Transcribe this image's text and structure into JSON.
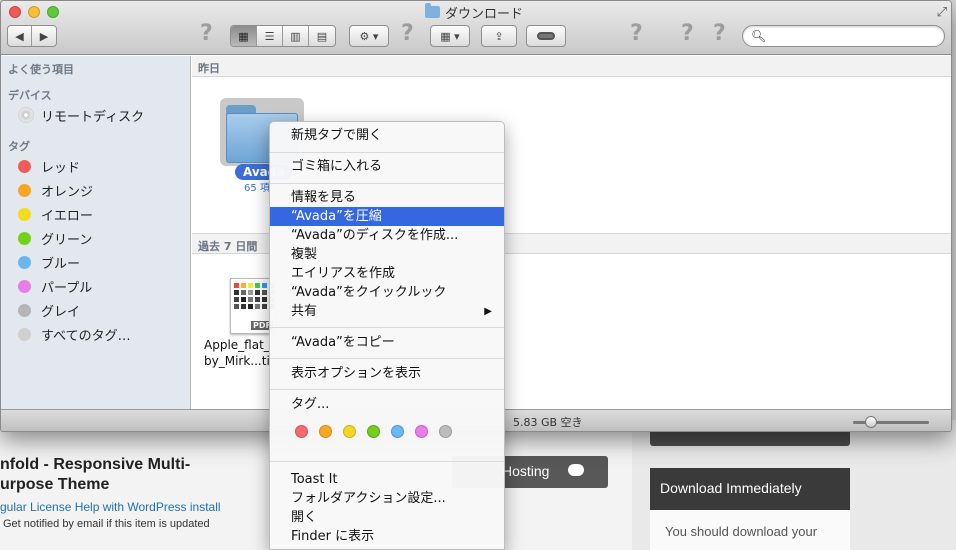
{
  "background_page": {
    "title": "nfold - Responsive Multi-urpose Theme",
    "title_line1": "nfold - Responsive Multi-",
    "title_line2": "urpose Theme",
    "link": "gular License Help with WordPress install",
    "note": "Get notified by email if this item is updated",
    "hosting_button": "Hosting",
    "download_heading": "Download Immediately",
    "download_text": "You should download your"
  },
  "window": {
    "title": "ダウンロード"
  },
  "toolbar": {
    "back_icon": "back-arrow",
    "forward_icon": "forward-arrow",
    "view_modes": [
      "icon-view",
      "list-view",
      "column-view",
      "coverflow-view"
    ],
    "action_icon": "gear",
    "arrange_icon": "arrange-grid",
    "share_icon": "share",
    "tag_icon": "tag-toggle",
    "help_mark": "?",
    "search_placeholder": ""
  },
  "sidebar": {
    "favorites_heading": "よく使う項目",
    "devices_heading": "デバイス",
    "devices": [
      {
        "label": "リモートディスク",
        "icon": "disc-icon"
      }
    ],
    "tags_heading": "タグ",
    "tags": [
      {
        "label": "レッド",
        "color": "#f05b5b"
      },
      {
        "label": "オレンジ",
        "color": "#f6a623"
      },
      {
        "label": "イエロー",
        "color": "#f2dc1c"
      },
      {
        "label": "グリーン",
        "color": "#73d216"
      },
      {
        "label": "ブルー",
        "color": "#6ab7f0"
      },
      {
        "label": "パープル",
        "color": "#e77de6"
      },
      {
        "label": "グレイ",
        "color": "#b5b5b5"
      },
      {
        "label": "すべてのタグ…",
        "color": "#d0d0d0"
      }
    ]
  },
  "content": {
    "group1_label": "昨日",
    "folder_name": "Avada",
    "folder_count": "65 項",
    "group2_label": "過去 7 日間",
    "file_name_line1": "Apple_flat_",
    "file_name_line2": "by_Mirk...ti",
    "file_badge": "PDF"
  },
  "statusbar": {
    "text": "5.83 GB 空き"
  },
  "context_menu": {
    "items": [
      {
        "label": "新規タブで開く"
      },
      {
        "label": "ゴミ箱に入れる"
      },
      {
        "label": "情報を見る"
      },
      {
        "label": "“Avada”を圧縮",
        "highlighted": true
      },
      {
        "label": "“Avada”のディスクを作成..."
      },
      {
        "label": "複製"
      },
      {
        "label": "エイリアスを作成"
      },
      {
        "label": "“Avada”をクイックルック"
      },
      {
        "label": "共有",
        "submenu": true
      },
      {
        "label": "“Avada”をコピー"
      },
      {
        "label": "表示オプションを表示"
      },
      {
        "label": "タグ..."
      },
      {
        "label": "Toast It"
      },
      {
        "label": "フォルダアクション設定..."
      },
      {
        "label": "開く"
      },
      {
        "label": "Finder に表示"
      }
    ],
    "submenu_arrow": "▶",
    "tag_colors": [
      "#f36b6b",
      "#f7a826",
      "#f3d625",
      "#76cc1f",
      "#6cb8f2",
      "#ea7ee9",
      "#bdbdbd"
    ]
  }
}
